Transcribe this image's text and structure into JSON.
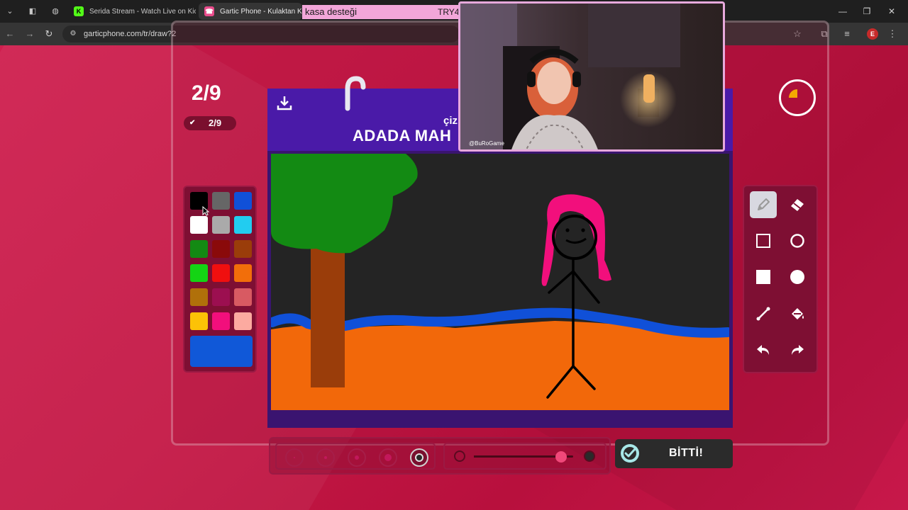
{
  "browser": {
    "tabs": [
      {
        "label": "Serida Stream - Watch Live on Kick",
        "favicon": "kick-logo",
        "color": "#53fc18",
        "active": false
      },
      {
        "label": "Gartic Phone - Kulaktan Kulağa",
        "favicon": "phone-logo",
        "color": "#e84c8b",
        "active": true
      }
    ],
    "url": "garticphone.com/tr/draw?2",
    "profile_initial": "E"
  },
  "stream_overlay": {
    "banner_text": "kasa desteği",
    "banner_code": "TRY4",
    "cam_label": "@BuRoGame"
  },
  "game": {
    "round_big": "2/9",
    "round_pill": "2/9",
    "prompt_label": "çiz",
    "prompt_text": "ADADA MAH",
    "done_label": "BİTTİ!",
    "palette": {
      "colors": [
        "#000000",
        "#666666",
        "#1050d8",
        "#ffffff",
        "#aaaaaa",
        "#22ccf0",
        "#138a13",
        "#8a0a0a",
        "#9a3d0a",
        "#14d414",
        "#f00f0f",
        "#f26e0a",
        "#b0700a",
        "#9c0f50",
        "#d85a62",
        "#fcc206",
        "#f20f7c",
        "#fcaaa0"
      ],
      "current": "#1058d8"
    },
    "tools": [
      {
        "name": "pen-tool",
        "selected": true
      },
      {
        "name": "eraser-tool",
        "selected": false
      },
      {
        "name": "rectangle-outline-tool",
        "selected": false
      },
      {
        "name": "circle-outline-tool",
        "selected": false
      },
      {
        "name": "rectangle-fill-tool",
        "selected": false
      },
      {
        "name": "circle-fill-tool",
        "selected": false
      },
      {
        "name": "line-tool",
        "selected": false
      },
      {
        "name": "fill-bucket-tool",
        "selected": false
      },
      {
        "name": "undo-tool",
        "selected": false
      },
      {
        "name": "redo-tool",
        "selected": false
      }
    ],
    "brush_sizes": [
      {
        "level": 1,
        "selected": false
      },
      {
        "level": 2,
        "selected": false
      },
      {
        "level": 3,
        "selected": false
      },
      {
        "level": 4,
        "selected": false
      },
      {
        "level": 5,
        "selected": true
      }
    ],
    "opacity_level": 0.88,
    "timer_fraction_elapsed": 0.25
  },
  "colors": {
    "page_bg": "#c41845",
    "header_purple": "#4a1aa8",
    "canvas_bg": "#242424"
  }
}
